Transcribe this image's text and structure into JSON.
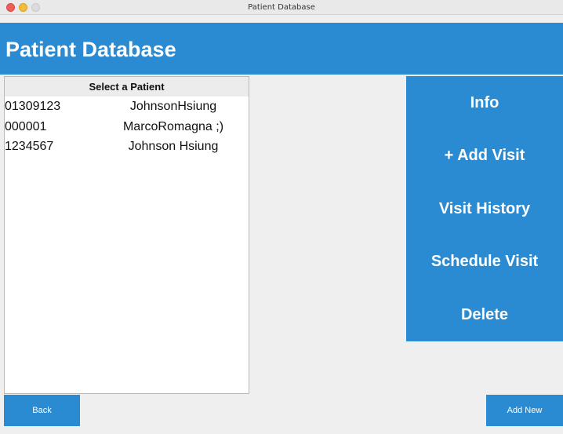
{
  "window": {
    "title": "Patient Database"
  },
  "header": {
    "title": "Patient Database"
  },
  "patient_list": {
    "header": "Select a Patient",
    "patients": [
      {
        "id": "01309123",
        "name": "JohnsonHsiung"
      },
      {
        "id": "000001",
        "name": "MarcoRomagna ;)"
      },
      {
        "id": "1234567",
        "name": "Johnson Hsiung"
      }
    ]
  },
  "actions": {
    "info": "Info",
    "add_visit": "+ Add Visit",
    "visit_history": "Visit History",
    "schedule_visit": "Schedule Visit",
    "delete": "Delete"
  },
  "footer": {
    "back": "Back",
    "add_new": "Add New"
  },
  "colors": {
    "accent": "#2b8bd2",
    "background": "#efefef",
    "panel": "#ffffff"
  }
}
